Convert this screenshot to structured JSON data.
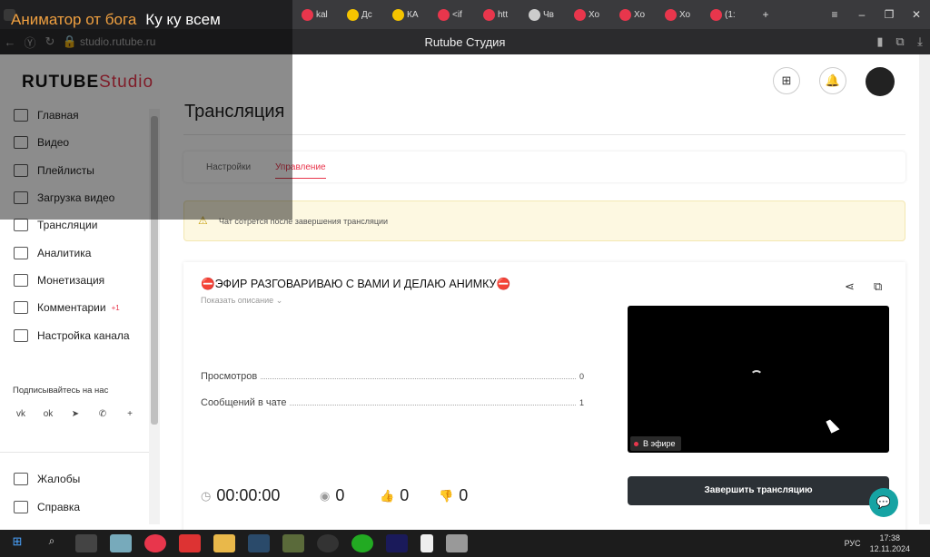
{
  "overlay": {
    "title": "Аниматор от бога",
    "subtitle": "Ку ку всем"
  },
  "browser": {
    "tabs": [
      {
        "label": "kal",
        "color": "#e8364c"
      },
      {
        "label": "Дс",
        "color": "#f5c400"
      },
      {
        "label": "КА",
        "color": "#f5c400"
      },
      {
        "label": "<if",
        "color": "#e8364c"
      },
      {
        "label": "htt",
        "color": "#e8364c"
      },
      {
        "label": "Чв",
        "color": "#cccccc"
      },
      {
        "label": "Хо",
        "color": "#e8364c"
      },
      {
        "label": "Хо",
        "color": "#e8364c"
      },
      {
        "label": "Хо",
        "color": "#e8364c"
      },
      {
        "label": "(1:",
        "color": "#e8364c"
      }
    ],
    "url": "studio.rutube.ru",
    "page_title": "Rutube Студия"
  },
  "logo": {
    "main": "RUTUBE",
    "suffix": "Studio"
  },
  "sidebar": {
    "items": [
      {
        "label": "Главная"
      },
      {
        "label": "Видео"
      },
      {
        "label": "Плейлисты"
      },
      {
        "label": "Загрузка видео"
      },
      {
        "label": "Трансляции"
      },
      {
        "label": "Аналитика"
      },
      {
        "label": "Монетизация"
      },
      {
        "label": "Комментарии",
        "badge": "+1"
      },
      {
        "label": "Настройка канала"
      }
    ],
    "follow_label": "Подписывайтесь на нас",
    "socials": [
      "vk-icon",
      "ok-icon",
      "telegram-icon",
      "viber-icon",
      "plus-icon"
    ],
    "footer_items": [
      {
        "label": "Жалобы"
      },
      {
        "label": "Справка"
      }
    ]
  },
  "page": {
    "heading": "Трансляция",
    "tabs": [
      {
        "label": "Настройки"
      },
      {
        "label": "Управление"
      }
    ],
    "warning": "Чат сотрется после завершения трансляции",
    "stream_title": "⛔ЭФИР РАЗГОВАРИВАЮ С ВАМИ И ДЕЛАЮ АНИМКУ⛔",
    "show_description": "Показать описание",
    "stats": [
      {
        "label": "Просмотров",
        "value": "0"
      },
      {
        "label": "Сообщений в чате",
        "value": "1"
      }
    ],
    "live_badge": "В эфире",
    "duration": "00:00:00",
    "viewers": "0",
    "likes": "0",
    "dislikes": "0",
    "end_button": "Завершить трансляцию"
  },
  "taskbar": {
    "time": "17:38",
    "date": "12.11.2024",
    "lang": "РУС"
  },
  "colors": {
    "accent": "#e8364c",
    "dark_button": "#2c3136",
    "chat_button": "#16a3a3"
  }
}
